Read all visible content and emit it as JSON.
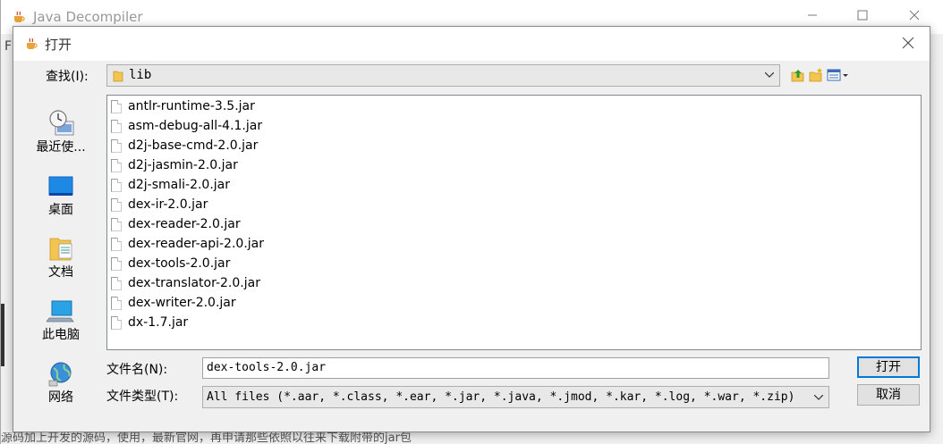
{
  "main_window": {
    "title": "Java Decompiler",
    "menu_fragment": "F",
    "bottom_text": "源码加上开发的源码，使用，最新官网，再申请那些依照以往来下载附带的jar包"
  },
  "dialog": {
    "title": "打开",
    "look_in": {
      "label": "查找(I):",
      "value": "lib"
    },
    "places": [
      {
        "label": "最近使...",
        "icon": "recent-icon"
      },
      {
        "label": "桌面",
        "icon": "desktop-icon"
      },
      {
        "label": "文档",
        "icon": "documents-icon"
      },
      {
        "label": "此电脑",
        "icon": "computer-icon"
      },
      {
        "label": "网络",
        "icon": "network-icon"
      }
    ],
    "files": [
      "antlr-runtime-3.5.jar",
      "asm-debug-all-4.1.jar",
      "d2j-base-cmd-2.0.jar",
      "d2j-jasmin-2.0.jar",
      "d2j-smali-2.0.jar",
      "dex-ir-2.0.jar",
      "dex-reader-2.0.jar",
      "dex-reader-api-2.0.jar",
      "dex-tools-2.0.jar",
      "dex-translator-2.0.jar",
      "dex-writer-2.0.jar",
      "dx-1.7.jar"
    ],
    "file_name": {
      "label": "文件名(N):",
      "value": "dex-tools-2.0.jar"
    },
    "file_type": {
      "label": "文件类型(T):",
      "value": "All files (*.aar, *.class, *.ear, *.jar, *.java, *.jmod, *.kar, *.log, *.war, *.zip)"
    },
    "open_button": "打开",
    "cancel_button": "取消"
  }
}
